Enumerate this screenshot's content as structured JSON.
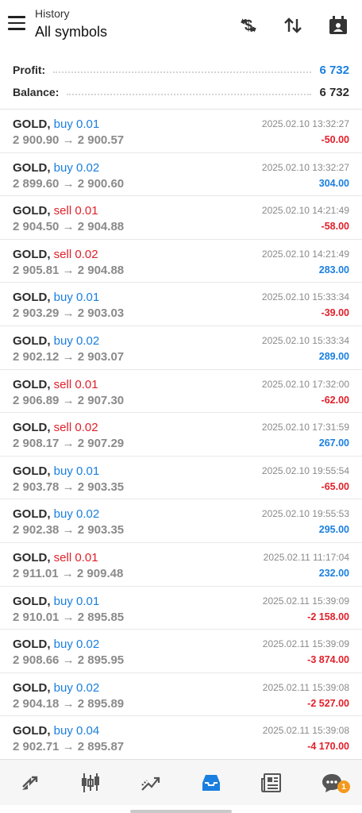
{
  "header": {
    "subtitle": "History",
    "title": "All symbols",
    "icons": [
      "currency-exchange-icon",
      "sort-icon",
      "calendar-icon"
    ]
  },
  "summary": {
    "profit_label": "Profit:",
    "profit_value": "6 732",
    "balance_label": "Balance:",
    "balance_value": "6 732"
  },
  "deals": [
    {
      "symbol": "GOLD,",
      "side": "buy",
      "volume": "0.01",
      "open": "2 900.90",
      "close": "2 900.57",
      "time": "2025.02.10 13:32:27",
      "pl": "-50.00"
    },
    {
      "symbol": "GOLD,",
      "side": "buy",
      "volume": "0.02",
      "open": "2 899.60",
      "close": "2 900.60",
      "time": "2025.02.10 13:32:27",
      "pl": "304.00"
    },
    {
      "symbol": "GOLD,",
      "side": "sell",
      "volume": "0.01",
      "open": "2 904.50",
      "close": "2 904.88",
      "time": "2025.02.10 14:21:49",
      "pl": "-58.00"
    },
    {
      "symbol": "GOLD,",
      "side": "sell",
      "volume": "0.02",
      "open": "2 905.81",
      "close": "2 904.88",
      "time": "2025.02.10 14:21:49",
      "pl": "283.00"
    },
    {
      "symbol": "GOLD,",
      "side": "buy",
      "volume": "0.01",
      "open": "2 903.29",
      "close": "2 903.03",
      "time": "2025.02.10 15:33:34",
      "pl": "-39.00"
    },
    {
      "symbol": "GOLD,",
      "side": "buy",
      "volume": "0.02",
      "open": "2 902.12",
      "close": "2 903.07",
      "time": "2025.02.10 15:33:34",
      "pl": "289.00"
    },
    {
      "symbol": "GOLD,",
      "side": "sell",
      "volume": "0.01",
      "open": "2 906.89",
      "close": "2 907.30",
      "time": "2025.02.10 17:32:00",
      "pl": "-62.00"
    },
    {
      "symbol": "GOLD,",
      "side": "sell",
      "volume": "0.02",
      "open": "2 908.17",
      "close": "2 907.29",
      "time": "2025.02.10 17:31:59",
      "pl": "267.00"
    },
    {
      "symbol": "GOLD,",
      "side": "buy",
      "volume": "0.01",
      "open": "2 903.78",
      "close": "2 903.35",
      "time": "2025.02.10 19:55:54",
      "pl": "-65.00"
    },
    {
      "symbol": "GOLD,",
      "side": "buy",
      "volume": "0.02",
      "open": "2 902.38",
      "close": "2 903.35",
      "time": "2025.02.10 19:55:53",
      "pl": "295.00"
    },
    {
      "symbol": "GOLD,",
      "side": "sell",
      "volume": "0.01",
      "open": "2 911.01",
      "close": "2 909.48",
      "time": "2025.02.11 11:17:04",
      "pl": "232.00"
    },
    {
      "symbol": "GOLD,",
      "side": "buy",
      "volume": "0.01",
      "open": "2 910.01",
      "close": "2 895.85",
      "time": "2025.02.11 15:39:09",
      "pl": "-2 158.00"
    },
    {
      "symbol": "GOLD,",
      "side": "buy",
      "volume": "0.02",
      "open": "2 908.66",
      "close": "2 895.95",
      "time": "2025.02.11 15:39:09",
      "pl": "-3 874.00"
    },
    {
      "symbol": "GOLD,",
      "side": "buy",
      "volume": "0.02",
      "open": "2 904.18",
      "close": "2 895.89",
      "time": "2025.02.11 15:39:08",
      "pl": "-2 527.00"
    },
    {
      "symbol": "GOLD,",
      "side": "buy",
      "volume": "0.04",
      "open": "2 902.71",
      "close": "2 895.87",
      "time": "2025.02.11 15:39:08",
      "pl": "-4 170.00"
    }
  ],
  "arrow": "→",
  "bottom_nav": {
    "items": [
      "quotes-icon",
      "chart-icon",
      "trade-icon",
      "history-icon",
      "news-icon",
      "chat-icon"
    ],
    "active": "history-icon",
    "chat_badge": "1"
  },
  "colors": {
    "accent_blue": "#1a7fe0",
    "loss_red": "#e0202a",
    "badge_orange": "#f39a1e"
  }
}
